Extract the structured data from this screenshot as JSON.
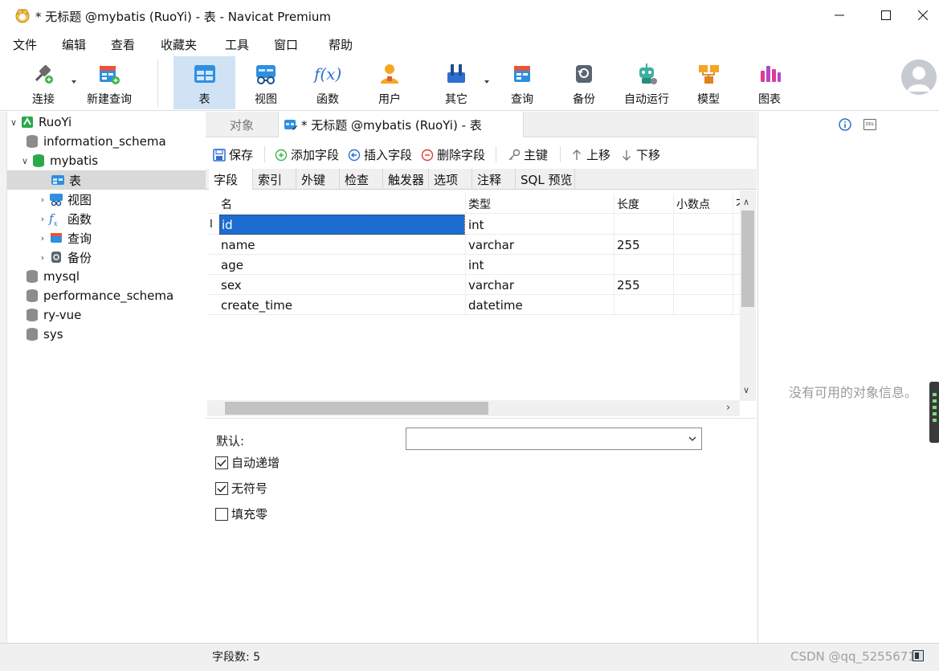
{
  "window": {
    "title": "* 无标题 @mybatis (RuoYi) - 表 - Navicat Premium"
  },
  "menu": [
    "文件",
    "编辑",
    "查看",
    "收藏夹",
    "工具",
    "窗口",
    "帮助"
  ],
  "toolbar": {
    "connect": "连接",
    "new_query": "新建查询",
    "table": "表",
    "view": "视图",
    "function": "函数",
    "user": "用户",
    "other": "其它",
    "query": "查询",
    "backup": "备份",
    "automation": "自动运行",
    "model": "模型",
    "chart": "图表",
    "function_glyph": "f(x)"
  },
  "tree": {
    "connection": "RuoYi",
    "db_information_schema": "information_schema",
    "db_mybatis": "mybatis",
    "node_table": "表",
    "node_view": "视图",
    "node_function": "函数",
    "node_query": "查询",
    "node_backup": "备份",
    "db_mysql": "mysql",
    "db_performance_schema": "performance_schema",
    "db_ry_vue": "ry-vue",
    "db_sys": "sys"
  },
  "tabs": {
    "objects": "对象",
    "document": "* 无标题 @mybatis (RuoYi) - 表"
  },
  "object_toolbar": {
    "save": "保存",
    "add_field": "添加字段",
    "insert_field": "插入字段",
    "delete_field": "删除字段",
    "primary_key": "主键",
    "move_up": "上移",
    "move_down": "下移"
  },
  "sub_tabs": [
    "字段",
    "索引",
    "外键",
    "检查",
    "触发器",
    "选项",
    "注释",
    "SQL 预览"
  ],
  "grid": {
    "headers": [
      "名",
      "类型",
      "长度",
      "小数点",
      "不"
    ],
    "rows": [
      {
        "name": "id",
        "type": "int",
        "length": "",
        "decimal": ""
      },
      {
        "name": "name",
        "type": "varchar",
        "length": "255",
        "decimal": ""
      },
      {
        "name": "age",
        "type": "int",
        "length": "",
        "decimal": ""
      },
      {
        "name": "sex",
        "type": "varchar",
        "length": "255",
        "decimal": ""
      },
      {
        "name": "create_time",
        "type": "datetime",
        "length": "",
        "decimal": ""
      }
    ]
  },
  "properties": {
    "default_label": "默认:",
    "default_value": "",
    "auto_increment": "自动递增",
    "auto_increment_checked": true,
    "unsigned": "无符号",
    "unsigned_checked": true,
    "zerofill": "填充零",
    "zerofill_checked": false
  },
  "info_pane": {
    "empty_message": "没有可用的对象信息。",
    "ddl_label": "DDL"
  },
  "status": {
    "field_count": "字段数: 5",
    "watermark": "CSDN @qq_52556714"
  },
  "colors": {
    "selection": "#1d6cd1",
    "active_tool": "#cfe3f5",
    "tree_selected": "#d9d9d9",
    "db_active": "#2aa84a",
    "db_inactive": "#8c8c8c"
  }
}
